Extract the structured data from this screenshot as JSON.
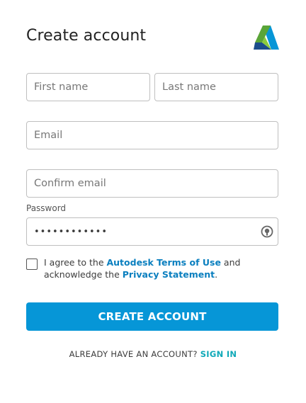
{
  "header": {
    "title": "Create account"
  },
  "logo": {
    "icon": "autodesk-logo-icon",
    "colors": [
      "#5aa538",
      "#0696d7",
      "#1b4d8c",
      "#8acb3c"
    ]
  },
  "form": {
    "first_name_placeholder": "First name",
    "last_name_placeholder": "Last name",
    "email_placeholder": "Email",
    "confirm_email_placeholder": "Confirm email",
    "password_label": "Password",
    "password_value": "••••••••••••",
    "password_toggle_icon": "eye-icon"
  },
  "agreement": {
    "prefix": "I agree to the ",
    "terms_link": "Autodesk Terms of Use",
    "middle": " and acknowledge the ",
    "privacy_link": "Privacy Statement",
    "suffix": ".",
    "checked": false
  },
  "actions": {
    "create_label": "CREATE ACCOUNT",
    "create_color": "#0696d7",
    "have_account_text": "ALREADY HAVE AN ACCOUNT? ",
    "sign_in_label": "SIGN IN",
    "sign_in_color": "#10a9b8"
  }
}
